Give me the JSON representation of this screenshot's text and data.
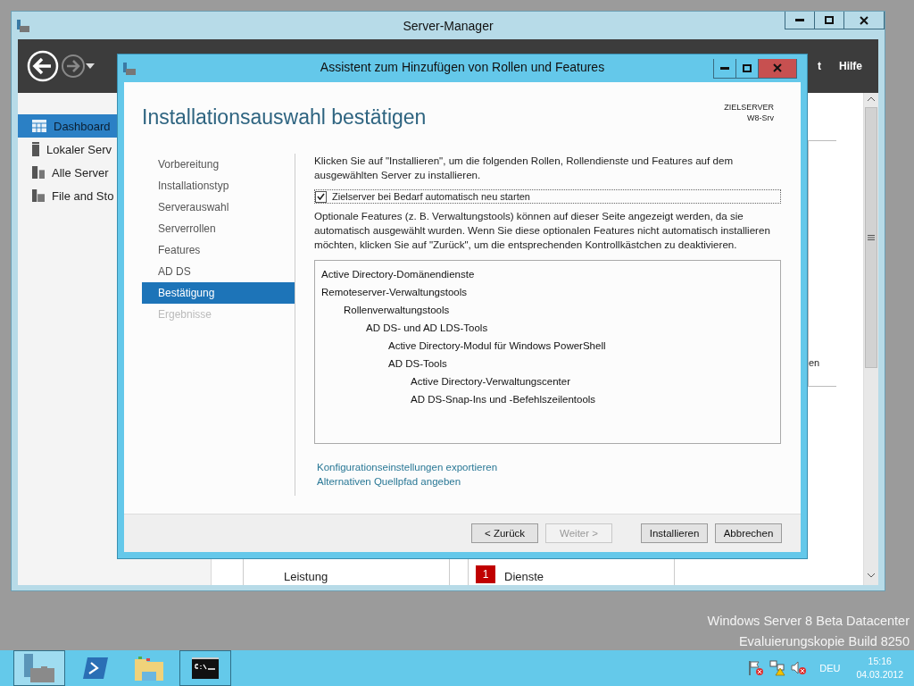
{
  "server_manager": {
    "title": "Server-Manager",
    "menu": [
      "t",
      "Hilfe"
    ],
    "sidebar": [
      {
        "label": "Dashboard",
        "kind": "dashboard",
        "selected": true
      },
      {
        "label": "Lokaler Serv",
        "kind": "server",
        "selected": false
      },
      {
        "label": "Alle Server",
        "kind": "servers",
        "selected": false
      },
      {
        "label": "File and Sto",
        "kind": "storage",
        "selected": false
      }
    ],
    "side_panel_text": "en",
    "tiles": [
      {
        "label": "Leistung"
      },
      {
        "badge": "1",
        "label": "Dienste"
      }
    ]
  },
  "dialog": {
    "title": "Assistent zum Hinzufügen von Rollen und Features",
    "heading": "Installationsauswahl bestätigen",
    "target_label": "ZIELSERVER",
    "target_server": "W8-Srv",
    "steps": [
      {
        "label": "Vorbereitung",
        "selected": false,
        "disabled": false
      },
      {
        "label": "Installationstyp",
        "selected": false,
        "disabled": false
      },
      {
        "label": "Serverauswahl",
        "selected": false,
        "disabled": false
      },
      {
        "label": "Serverrollen",
        "selected": false,
        "disabled": false
      },
      {
        "label": "Features",
        "selected": false,
        "disabled": false
      },
      {
        "label": "AD DS",
        "selected": false,
        "disabled": false
      },
      {
        "label": "Bestätigung",
        "selected": true,
        "disabled": false
      },
      {
        "label": "Ergebnisse",
        "selected": false,
        "disabled": true
      }
    ],
    "intro": "Klicken Sie auf \"Installieren\", um die folgenden Rollen, Rollendienste und Features auf dem ausgewählten Server zu installieren.",
    "restart_checkbox": {
      "label": "Zielserver bei Bedarf automatisch neu starten",
      "checked": true
    },
    "note": "Optionale Features (z. B. Verwaltungstools) können auf dieser Seite angezeigt werden, da sie automatisch ausgewählt wurden. Wenn Sie diese optionalen Features nicht automatisch installieren möchten, klicken Sie auf \"Zurück\", um die entsprechenden Kontrollkästchen zu deaktivieren.",
    "features": [
      {
        "label": "Active Directory-Domänendienste"
      },
      {
        "label": "Remoteserver-Verwaltungstools",
        "children": [
          {
            "label": "Rollenverwaltungstools",
            "children": [
              {
                "label": "AD DS- und AD LDS-Tools",
                "children": [
                  {
                    "label": "Active Directory-Modul für Windows PowerShell"
                  },
                  {
                    "label": "AD DS-Tools",
                    "children": [
                      {
                        "label": "Active Directory-Verwaltungscenter"
                      },
                      {
                        "label": "AD DS-Snap-Ins und -Befehlszeilentools"
                      }
                    ]
                  }
                ]
              }
            ]
          }
        ]
      }
    ],
    "links": [
      "Konfigurationseinstellungen exportieren",
      "Alternativen Quellpfad angeben"
    ],
    "buttons": [
      {
        "label": "< Zurück",
        "disabled": false
      },
      {
        "label": "Weiter >",
        "disabled": true
      },
      {
        "label": "Installieren",
        "disabled": false
      },
      {
        "label": "Abbrechen",
        "disabled": false
      }
    ]
  },
  "desktop": {
    "watermark": [
      "Windows Server 8 Beta Datacenter",
      "Evaluierungskopie Build 8250"
    ]
  },
  "taskbar": {
    "apps": [
      {
        "kind": "server-manager",
        "selected": true,
        "running": true
      },
      {
        "kind": "powershell",
        "selected": false,
        "running": false
      },
      {
        "kind": "explorer",
        "selected": false,
        "running": false
      },
      {
        "kind": "cmd",
        "selected": false,
        "running": true
      }
    ],
    "tray": {
      "language": "DEU",
      "time": "15:16",
      "date": "04.03.2012"
    }
  }
}
